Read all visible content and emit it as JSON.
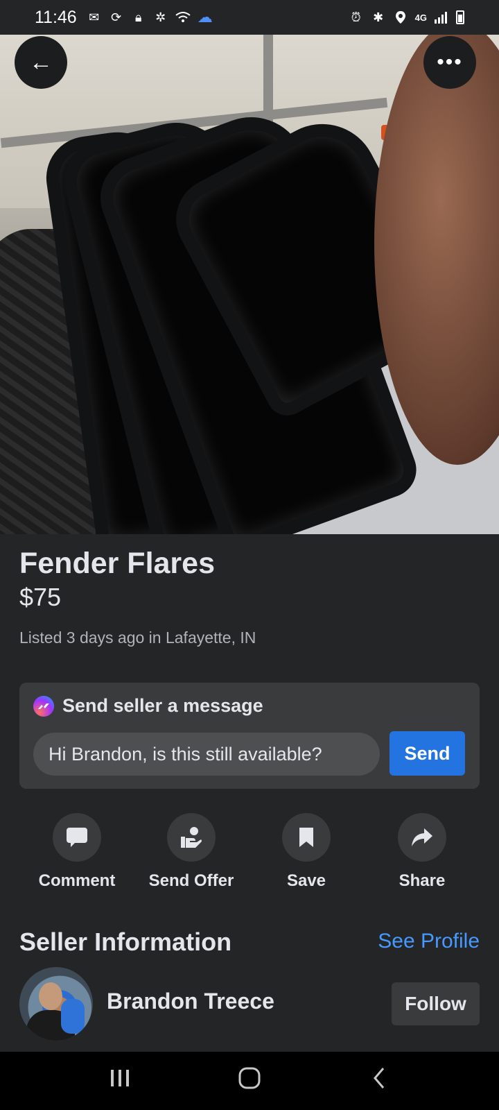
{
  "status_bar": {
    "time": "11:46",
    "network": "4G",
    "icons_left": [
      "mail-icon",
      "sync-icon",
      "lock-icon",
      "cluster-icon",
      "wifi-icon",
      "cloud-icon"
    ],
    "icons_right": [
      "alarm-icon",
      "bluetooth-icon",
      "location-icon",
      "network-icon",
      "signal-icon",
      "battery-icon"
    ]
  },
  "hero": {
    "back_glyph": "←",
    "more_glyph": "•••"
  },
  "listing": {
    "title": "Fender Flares",
    "price": "$75",
    "listed": "Listed 3 days ago in Lafayette, IN"
  },
  "message": {
    "heading": "Send seller a message",
    "input_value": "Hi Brandon, is this still available?",
    "send_label": "Send"
  },
  "actions": [
    {
      "label": "Comment",
      "icon": "comment-icon"
    },
    {
      "label": "Send Offer",
      "icon": "send-offer-icon"
    },
    {
      "label": "Save",
      "icon": "bookmark-icon"
    },
    {
      "label": "Share",
      "icon": "share-icon"
    }
  ],
  "seller": {
    "heading": "Seller Information",
    "see_profile": "See Profile",
    "name": "Brandon Treece",
    "follow_label": "Follow"
  },
  "colors": {
    "background": "#242526",
    "card": "#3a3b3c",
    "accent": "#2374e1",
    "link": "#4599ff"
  }
}
